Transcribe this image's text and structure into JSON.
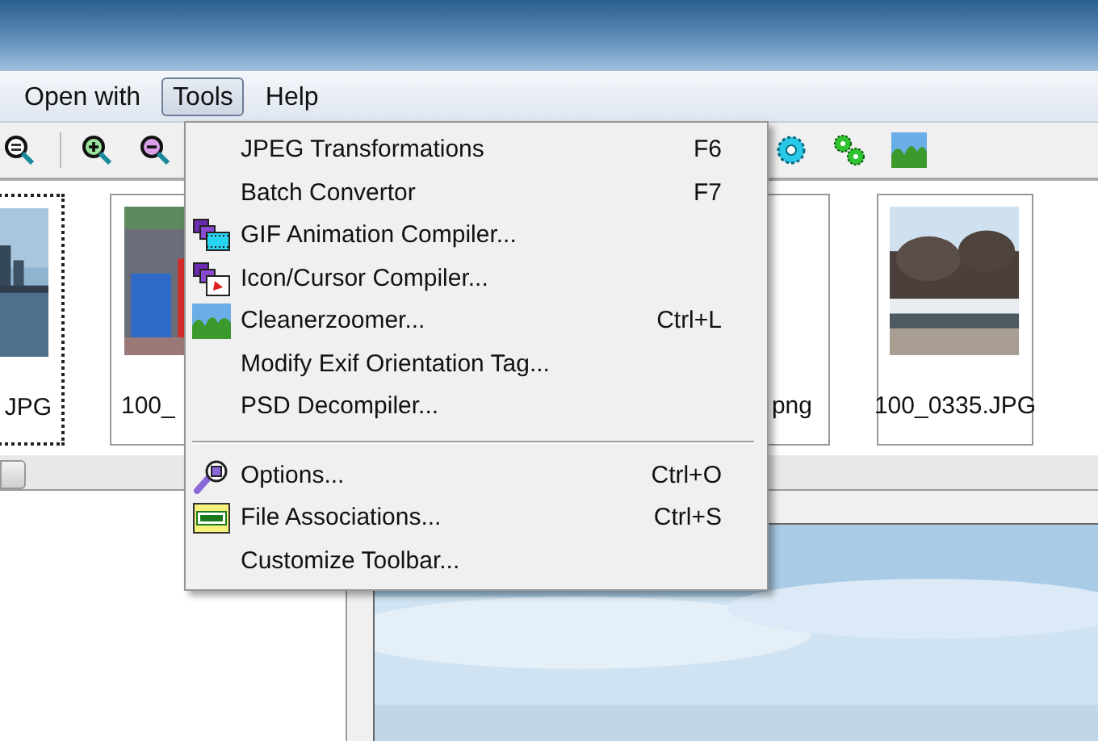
{
  "menu_bar": [
    {
      "label": "Open with",
      "selected": false
    },
    {
      "label": "Tools",
      "selected": true
    },
    {
      "label": "Help",
      "selected": false
    }
  ],
  "thumbnails": [
    {
      "label": "JPG",
      "selected": true
    },
    {
      "label": "100_",
      "selected": false
    },
    {
      "label": "png",
      "selected": false
    },
    {
      "label": "100_0335.JPG",
      "selected": false
    }
  ],
  "tools_menu": [
    {
      "kind": "plain",
      "label": "JPEG Transformations",
      "shortcut": "F6"
    },
    {
      "kind": "plain",
      "label": "Batch Convertor",
      "shortcut": "F7"
    },
    {
      "kind": "film",
      "label": "GIF Animation Compiler..."
    },
    {
      "kind": "cursor",
      "label": "Icon/Cursor Compiler..."
    },
    {
      "kind": "landscape",
      "label": "Cleanerzoomer...",
      "shortcut": "Ctrl+L"
    },
    {
      "kind": "plain",
      "label": "Modify Exif Orientation Tag..."
    },
    {
      "kind": "plain",
      "label": "PSD Decompiler..."
    },
    {
      "kind": "separator"
    },
    {
      "kind": "wrench",
      "label": "Options...",
      "shortcut": "Ctrl+O"
    },
    {
      "kind": "bmp",
      "label": "File Associations...",
      "shortcut": "Ctrl+S"
    },
    {
      "kind": "plain",
      "label": "Customize Toolbar..."
    }
  ]
}
